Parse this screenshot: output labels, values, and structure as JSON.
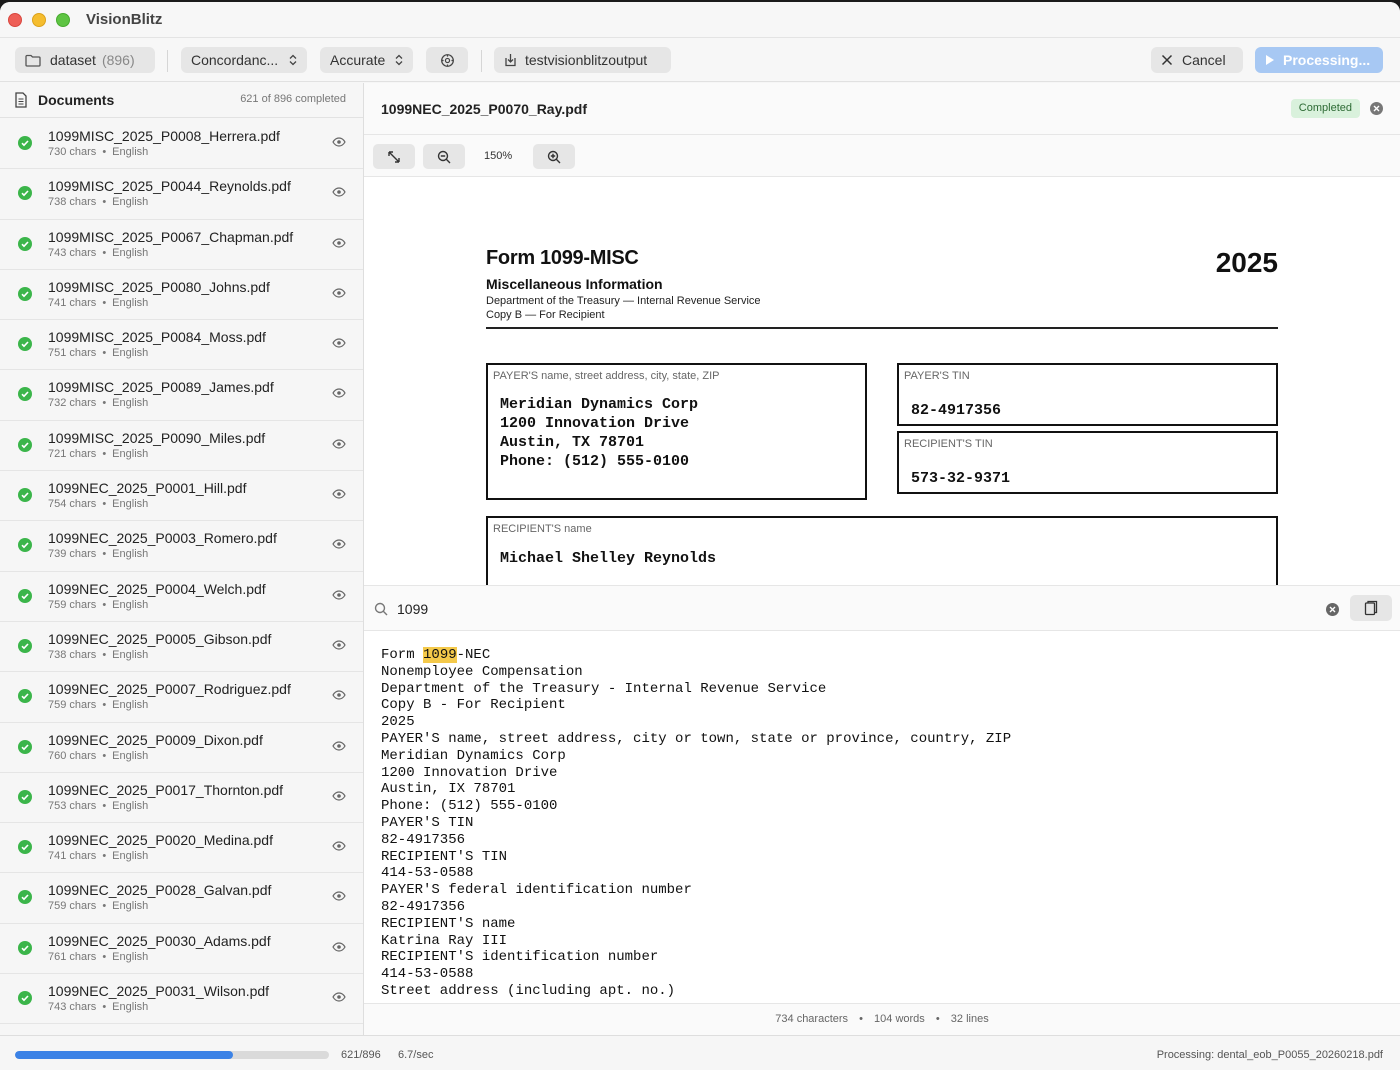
{
  "app": {
    "title": "VisionBlitz"
  },
  "toolbar": {
    "dataset_label": "dataset",
    "dataset_count": "(896)",
    "mode_select": "Concordanc...",
    "quality_select": "Accurate",
    "output_label": "testvisionblitzoutput",
    "cancel_label": "Cancel",
    "processing_label": "Processing..."
  },
  "sidebar": {
    "title": "Documents",
    "count": "621 of 896 completed",
    "items": [
      {
        "name": "1099MISC_2025_P0008_Herrera.pdf",
        "chars": "730 chars",
        "lang": "English"
      },
      {
        "name": "1099MISC_2025_P0044_Reynolds.pdf",
        "chars": "738 chars",
        "lang": "English"
      },
      {
        "name": "1099MISC_2025_P0067_Chapman.pdf",
        "chars": "743 chars",
        "lang": "English"
      },
      {
        "name": "1099MISC_2025_P0080_Johns.pdf",
        "chars": "741 chars",
        "lang": "English"
      },
      {
        "name": "1099MISC_2025_P0084_Moss.pdf",
        "chars": "751 chars",
        "lang": "English"
      },
      {
        "name": "1099MISC_2025_P0089_James.pdf",
        "chars": "732 chars",
        "lang": "English"
      },
      {
        "name": "1099MISC_2025_P0090_Miles.pdf",
        "chars": "721 chars",
        "lang": "English"
      },
      {
        "name": "1099NEC_2025_P0001_Hill.pdf",
        "chars": "754 chars",
        "lang": "English"
      },
      {
        "name": "1099NEC_2025_P0003_Romero.pdf",
        "chars": "739 chars",
        "lang": "English"
      },
      {
        "name": "1099NEC_2025_P0004_Welch.pdf",
        "chars": "759 chars",
        "lang": "English"
      },
      {
        "name": "1099NEC_2025_P0005_Gibson.pdf",
        "chars": "738 chars",
        "lang": "English"
      },
      {
        "name": "1099NEC_2025_P0007_Rodriguez.pdf",
        "chars": "759 chars",
        "lang": "English"
      },
      {
        "name": "1099NEC_2025_P0009_Dixon.pdf",
        "chars": "760 chars",
        "lang": "English"
      },
      {
        "name": "1099NEC_2025_P0017_Thornton.pdf",
        "chars": "753 chars",
        "lang": "English"
      },
      {
        "name": "1099NEC_2025_P0020_Medina.pdf",
        "chars": "741 chars",
        "lang": "English"
      },
      {
        "name": "1099NEC_2025_P0028_Galvan.pdf",
        "chars": "759 chars",
        "lang": "English"
      },
      {
        "name": "1099NEC_2025_P0030_Adams.pdf",
        "chars": "761 chars",
        "lang": "English"
      },
      {
        "name": "1099NEC_2025_P0031_Wilson.pdf",
        "chars": "743 chars",
        "lang": "English"
      }
    ]
  },
  "viewer": {
    "file_title": "1099NEC_2025_P0070_Ray.pdf",
    "status": "Completed",
    "zoom": "150%"
  },
  "document": {
    "form_title": "Form 1099-MISC",
    "year": "2025",
    "subtitle": "Miscellaneous Information",
    "department": "Department of the Treasury — Internal Revenue Service",
    "copy": "Copy B — For Recipient",
    "payer_label": "PAYER'S name, street address, city, state, ZIP",
    "payer_value": "Meridian Dynamics Corp\n1200 Innovation Drive\nAustin, TX 78701\nPhone: (512) 555-0100",
    "payer_tin_label": "PAYER'S TIN",
    "payer_tin_value": "82-4917356",
    "recipient_tin_label": "RECIPIENT'S TIN",
    "recipient_tin_value": "573-32-9371",
    "recipient_name_label": "RECIPIENT'S name",
    "recipient_name_value": "Michael Shelley Reynolds"
  },
  "search": {
    "query": "1099"
  },
  "text": {
    "lines": [
      "Form 1099-NEC",
      "Nonemployee Compensation",
      "Department of the Treasury - Internal Revenue Service",
      "Copy B - For Recipient",
      "2025",
      "PAYER'S name, street address, city or town, state or province, country, ZIP",
      "Meridian Dynamics Corp",
      "1200 Innovation Drive",
      "Austin, IX 78701",
      "Phone: (512) 555-0100",
      "PAYER'S TIN",
      "82-4917356",
      "RECIPIENT'S TIN",
      "414-53-0588",
      "PAYER'S federal identification number",
      "82-4917356",
      "RECIPIENT'S name",
      "Katrina Ray III",
      "RECIPIENT'S identification number",
      "414-53-0588",
      "Street address (including apt. no.)"
    ],
    "highlight": "1099"
  },
  "stats": {
    "characters": "734 characters",
    "words": "104 words",
    "lines": "32 lines"
  },
  "status": {
    "progress": 0.693,
    "count": "621/896",
    "rate": "6.7/sec",
    "processing": "Processing: dental_eob_P0055_20260218.pdf"
  },
  "colors": {
    "accent": "#3b82e6",
    "success": "#3bb54a",
    "highlight": "#f4c94a"
  }
}
